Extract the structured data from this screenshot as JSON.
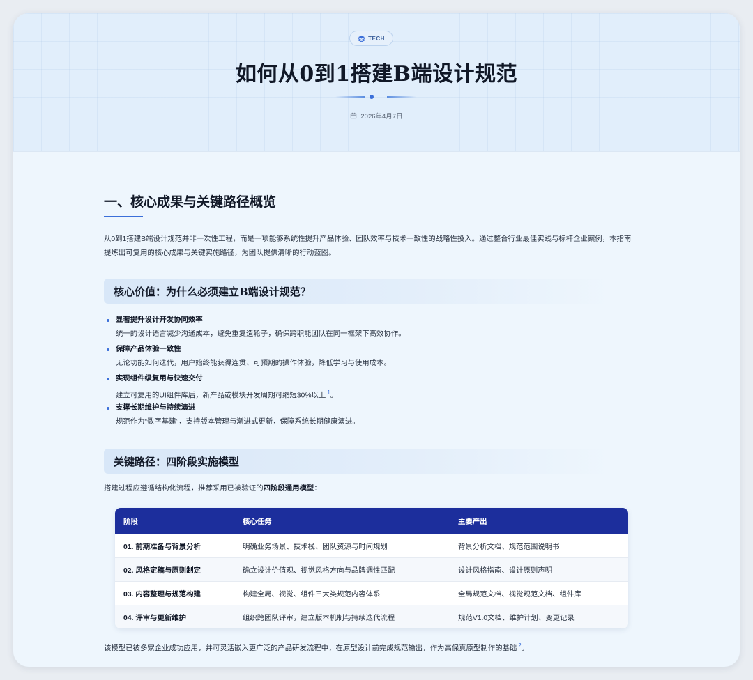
{
  "header": {
    "badge": "TECH",
    "title": "如何从0到1搭建B端设计规范",
    "date": "2026年4月7日"
  },
  "section1": {
    "title": "一、核心成果与关键路径概览",
    "intro": "从0到1搭建B端设计规范并非一次性工程，而是一项能够系统性提升产品体验、团队效率与技术一致性的战略性投入。通过整合行业最佳实践与标杆企业案例，本指南提炼出可复用的核心成果与关键实施路径，为团队提供清晰的行动蓝图。"
  },
  "value": {
    "heading": "核心价值：为什么必须建立B端设计规范？",
    "items": [
      {
        "title": "显著提升设计开发协同效率",
        "desc": "统一的设计语言减少沟通成本，避免重复造轮子，确保跨职能团队在同一框架下高效协作。",
        "ref": ""
      },
      {
        "title": "保障产品体验一致性",
        "desc": "无论功能如何迭代，用户始终能获得连贯、可预期的操作体验，降低学习与使用成本。",
        "ref": ""
      },
      {
        "title": "实现组件级复用与快速交付",
        "desc": "建立可复用的UI组件库后，新产品或模块开发周期可缩短30%以上",
        "ref": "1"
      },
      {
        "title": "支撑长期维护与持续演进",
        "desc": "规范作为“数字基建”，支持版本管理与渐进式更新，保障系统长期健康演进。",
        "ref": ""
      }
    ]
  },
  "path": {
    "heading": "关键路径：四阶段实施模型",
    "lead_prefix": "搭建过程应遵循结构化流程，推荐采用已被验证的",
    "lead_bold": "四阶段通用模型",
    "lead_suffix": "：",
    "table": {
      "headers": [
        "阶段",
        "核心任务",
        "主要产出"
      ],
      "rows": [
        [
          "01. 前期准备与背景分析",
          "明确业务场景、技术栈、团队资源与时间规划",
          "背景分析文档、规范范围说明书"
        ],
        [
          "02. 风格定稿与原则制定",
          "确立设计价值观、视觉风格方向与品牌调性匹配",
          "设计风格指南、设计原则声明"
        ],
        [
          "03. 内容整理与规范构建",
          "构建全局、视觉、组件三大类规范内容体系",
          "全局规范文档、视觉规范文档、组件库"
        ],
        [
          "04. 评审与更新维护",
          "组织跨团队评审，建立版本机制与持续迭代流程",
          "规范V1.0文档、维护计划、变更记录"
        ]
      ]
    },
    "outro": "该模型已被多家企业成功应用，并可灵活嵌入更广泛的产品研发流程中，在原型设计前完成规范输出，作为高保真原型制作的基础",
    "outro_ref": "2"
  },
  "colors": {
    "accent": "#3b6fd9",
    "table_header": "#1c2e9c",
    "background": "#eef6fd"
  },
  "icons": {
    "badge": "layers-icon",
    "date": "calendar-icon"
  }
}
